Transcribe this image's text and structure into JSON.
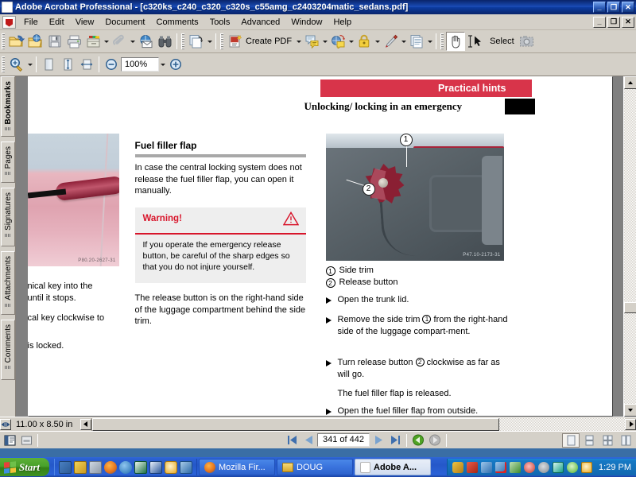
{
  "window": {
    "title": "Adobe Acrobat Professional - [c320ks_c240_c320_c320s_c55amg_c2403204matic_sedans.pdf]",
    "minimize": "_",
    "restore": "❐",
    "close": "✕",
    "doc_minimize": "_",
    "doc_restore": "❐",
    "doc_close": "✕"
  },
  "menu": {
    "items": [
      "File",
      "Edit",
      "View",
      "Document",
      "Comments",
      "Tools",
      "Advanced",
      "Window",
      "Help"
    ]
  },
  "toolbar1": {
    "buttons": [
      {
        "name": "open-file",
        "icon": "folder-open-icon"
      },
      {
        "name": "open-web-file",
        "icon": "folder-globe-icon"
      },
      {
        "name": "save",
        "icon": "floppy-disk-icon"
      },
      {
        "name": "print",
        "icon": "printer-icon"
      },
      {
        "name": "email",
        "icon": "file-cabinet-icon",
        "dropdown": true
      },
      {
        "name": "attach",
        "icon": "paperclip-icon",
        "dropdown": true
      },
      {
        "name": "send-email",
        "icon": "globe-envelope-icon"
      },
      {
        "name": "search",
        "icon": "binoculars-icon"
      },
      {
        "name": "export-page",
        "icon": "page-export-icon",
        "dropdown": true
      }
    ],
    "create_pdf_label": "Create PDF",
    "review_comment_icon": "review-comment-icon",
    "send-review_icon": "send-for-review-icon",
    "secure_icon": "padlock-icon",
    "sign_icon": "pen-sign-icon",
    "forms_icon": "forms-icon",
    "hand_icon": "hand-tool-icon",
    "select_label": "Select",
    "select_icon": "select-text-icon",
    "snapshot_icon": "snapshot-camera-icon"
  },
  "toolbar2": {
    "zoom_tool_icon": "zoom-in-magnifier-icon",
    "actual_size_icon": "actual-size-page-icon",
    "fit_page_icon": "fit-page-height-icon",
    "fit_width_icon": "fit-page-width-icon",
    "zoom_out_icon": "zoom-out-circle-icon",
    "zoom_value": "100%",
    "zoom_in_icon": "zoom-in-circle-icon"
  },
  "navtabs": {
    "items": [
      {
        "label": "Bookmarks",
        "selected": true
      },
      {
        "label": "Pages",
        "selected": false
      },
      {
        "label": "Signatures",
        "selected": false
      },
      {
        "label": "Attachments",
        "selected": false
      },
      {
        "label": "Comments",
        "selected": false
      }
    ],
    "security_icon": "padlock-security-icon"
  },
  "document": {
    "header_banner": "Practical hints",
    "header_title": "Unlocking/ locking in an emergency",
    "left_column": {
      "image_caption": "P80.20-2627-31",
      "text_lines": [
        "nical key into the",
        "until it stops.",
        "cal key clockwise to",
        "is locked."
      ]
    },
    "mid_column": {
      "heading": "Fuel filler flap",
      "paragraph": "In case the central locking system does not release the fuel filler flap, you can open it manually.",
      "warning_title": "Warning!",
      "warning_icon": "warning-triangle-icon",
      "warning_body": "If you operate the emergency release button, be careful of the sharp edges so that you do not injure yourself.",
      "paragraph2": "The release button is on the right-hand side of the luggage compartment behind the side trim."
    },
    "right_column": {
      "image_caption": "P47.10-2173-31",
      "callout_1": "1",
      "callout_2": "2",
      "legend": [
        {
          "num": "1",
          "label": "Side trim"
        },
        {
          "num": "2",
          "label": "Release button"
        }
      ],
      "steps": [
        {
          "text": "Open the trunk lid."
        },
        {
          "text": "Remove the side trim ① from the right-hand side of the luggage compart-ment."
        },
        {
          "text": "Turn release button ② clockwise as far as will go."
        },
        {
          "text": "The fuel filler flap is released.",
          "no_bullet": true
        },
        {
          "text": "Open the fuel filler flap from outside."
        }
      ]
    }
  },
  "hscroll": {
    "page_size": "11.00 x 8.50 in"
  },
  "statusbar": {
    "sidebar_toggle_icon": "show-hide-sidebar-icon",
    "single_page_icon": "page-display-icon",
    "first_page_icon": "first-page-icon",
    "prev_page_icon": "previous-page-icon",
    "page_value": "341 of 442",
    "next_page_icon": "next-page-icon",
    "last_page_icon": "last-page-icon",
    "back_icon": "previous-view-back-icon",
    "forward_icon": "next-view-forward-icon",
    "layout_single_icon": "single-page-layout-icon",
    "layout_continuous_icon": "continuous-layout-icon",
    "layout_facing_icon": "facing-layout-icon",
    "layout_continuous_facing_icon": "continuous-facing-layout-icon"
  },
  "taskbar": {
    "start_label": "Start",
    "quicklaunch": [
      {
        "name": "show-desktop-icon",
        "color": "#4a7fc1"
      },
      {
        "name": "media-player-icon",
        "color": "#d6b23a"
      },
      {
        "name": "calculator-icon",
        "color": "#9fb0c4"
      },
      {
        "name": "firefox-icon",
        "color": "#e3701a"
      },
      {
        "name": "globe-browser-icon",
        "color": "#2b6fb8"
      },
      {
        "name": "excel-icon",
        "color": "#1d7044"
      },
      {
        "name": "word-icon",
        "color": "#2a5699"
      },
      {
        "name": "clock-icon",
        "color": "#e8a81f"
      },
      {
        "name": "network-computer-icon",
        "color": "#4a88c8"
      }
    ],
    "tasks": [
      {
        "label": "Mozilla Fir...",
        "icon": "firefox-icon",
        "active": false
      },
      {
        "label": "DOUG",
        "icon": "folder-icon",
        "active": false
      },
      {
        "label": "Adobe A...",
        "icon": "acrobat-icon",
        "active": true
      }
    ],
    "tray_icons": [
      "key-plug-icon",
      "network-monitor-icon",
      "display-icon",
      "network-disconnected-icon",
      "printer-tray-icon",
      "antivirus-icon",
      "shield-icon",
      "clipboard-icon",
      "check-shield-icon",
      "clock-tray-icon"
    ],
    "clock": "1:29 PM"
  }
}
